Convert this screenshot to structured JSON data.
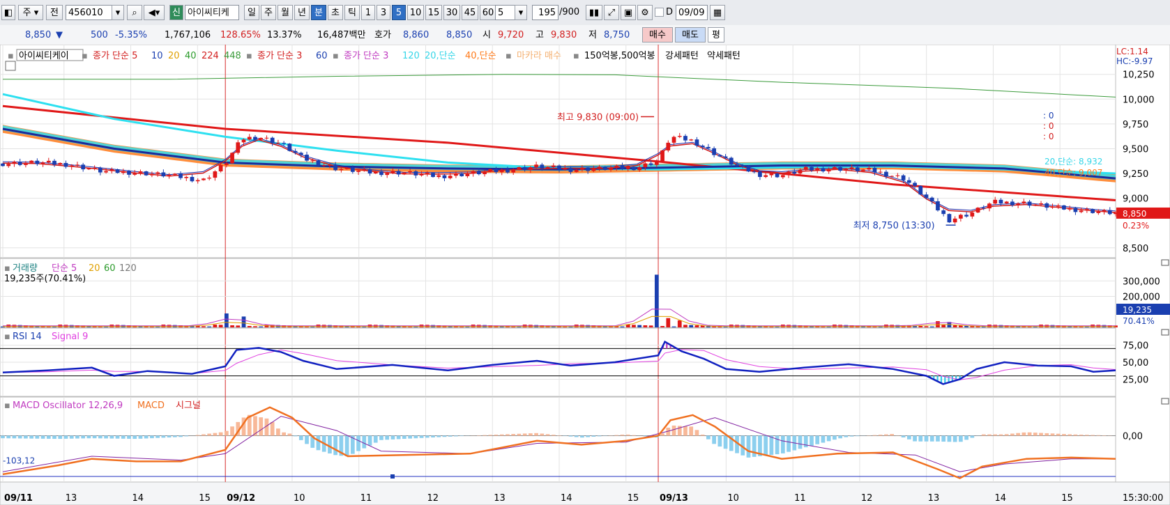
{
  "toolbar": {
    "market": "주",
    "prev": "전",
    "code": "456010",
    "new_badge": "신",
    "name": "아이씨티케",
    "periods": [
      "일",
      "주",
      "월",
      "년",
      "분",
      "초",
      "틱"
    ],
    "active_period": "분",
    "intervals": [
      "1",
      "3",
      "5",
      "10",
      "15",
      "30",
      "45",
      "60"
    ],
    "active_interval": "5",
    "interval_select": "5",
    "count": "195",
    "count_total": "/900",
    "date": "09/09"
  },
  "infobar": {
    "price": "8,850",
    "change_arrow": "▼",
    "change": "500",
    "change_pct": "-5.35%",
    "volume": "1,767,106",
    "vol_ratio": "128.65%",
    "turnover": "13.37%",
    "amount": "16,487백만",
    "quote_label": "호가",
    "ask": "8,860",
    "bid": "8,850",
    "open_label": "시",
    "open": "9,720",
    "high_label": "고",
    "high": "9,830",
    "low_label": "저",
    "low": "8,750",
    "buy_btn": "매수",
    "sell_btn": "매도",
    "eval_btn": "평"
  },
  "chart_data": {
    "type": "candlestick",
    "interval": "5분",
    "price_ylim": [
      8400,
      10550
    ],
    "price_ticks": [
      {
        "v": 10250,
        "t": "10,250"
      },
      {
        "v": 10000,
        "t": "10,000"
      },
      {
        "v": 9750,
        "t": "9,750"
      },
      {
        "v": 9500,
        "t": "9,500"
      },
      {
        "v": 9250,
        "t": "9,250"
      },
      {
        "v": 9000,
        "t": "9,000"
      },
      {
        "v": 8500,
        "t": "8,500"
      }
    ],
    "x_labels": [
      {
        "p": 0,
        "t": "09/11",
        "bold": true
      },
      {
        "p": 0.055,
        "t": "13"
      },
      {
        "p": 0.115,
        "t": "14"
      },
      {
        "p": 0.175,
        "t": "15"
      },
      {
        "p": 0.2,
        "t": "09/12",
        "bold": true
      },
      {
        "p": 0.26,
        "t": "10"
      },
      {
        "p": 0.32,
        "t": "11"
      },
      {
        "p": 0.38,
        "t": "12"
      },
      {
        "p": 0.44,
        "t": "13"
      },
      {
        "p": 0.5,
        "t": "14"
      },
      {
        "p": 0.56,
        "t": "15"
      },
      {
        "p": 0.589,
        "t": "09/13",
        "bold": true
      },
      {
        "p": 0.65,
        "t": "10"
      },
      {
        "p": 0.71,
        "t": "11"
      },
      {
        "p": 0.77,
        "t": "12"
      },
      {
        "p": 0.83,
        "t": "13"
      },
      {
        "p": 0.89,
        "t": "14"
      },
      {
        "p": 0.95,
        "t": "15"
      }
    ],
    "time_end": "15:30:00",
    "day_dividers": [
      0.2,
      0.589
    ],
    "lc": "LC:1.14",
    "hc": "HC:-9.97",
    "zero_labels": [
      ": 0",
      ": 0",
      ": 0"
    ],
    "legend": {
      "name": "아이씨티케이",
      "ma1": "종가 단순 5",
      "ma1_periods": [
        "10",
        "20",
        "40",
        "224",
        "448"
      ],
      "ma2": "종가 단순 3",
      "ma2_periods": [
        "60"
      ],
      "ma3": "종가 단순 3",
      "ma3_periods": [
        "120"
      ],
      "ma_20": "20,단순",
      "ma_40": "40,단순",
      "makara": "마카라 매수",
      "pattern": "150억봉,500억봉",
      "strong": "강세패턴",
      "weak": "약세패턴"
    },
    "right_labels": {
      "ma20": "20,단순: 8,932",
      "ma40": "40,단순: 9,007"
    },
    "ma20_value": 8932,
    "ma40_value": 9007,
    "current": {
      "price": 8850,
      "label": "8,850",
      "pct": "0.23%"
    },
    "high_annot": {
      "label": "최고 9,830 (09:00)",
      "value": 9830,
      "p": 0.589
    },
    "low_annot": {
      "label": "최저 8,750 (13:30)",
      "value": 8750,
      "p": 0.855
    },
    "ma224": [
      [
        0,
        9930
      ],
      [
        0.2,
        9700
      ],
      [
        0.4,
        9560
      ],
      [
        0.589,
        9370
      ],
      [
        0.8,
        9140
      ],
      [
        1,
        8980
      ]
    ],
    "ma448": [
      [
        0,
        10200
      ],
      [
        0.15,
        10200
      ],
      [
        0.3,
        10230
      ],
      [
        0.45,
        10250
      ],
      [
        0.55,
        10245
      ],
      [
        0.7,
        10170
      ],
      [
        0.85,
        10110
      ],
      [
        1,
        10020
      ]
    ],
    "ma120": [
      [
        0,
        10050
      ],
      [
        0.1,
        9800
      ],
      [
        0.2,
        9620
      ],
      [
        0.3,
        9480
      ],
      [
        0.4,
        9360
      ],
      [
        0.5,
        9300
      ],
      [
        0.589,
        9290
      ],
      [
        0.7,
        9310
      ],
      [
        0.8,
        9320
      ],
      [
        0.9,
        9290
      ],
      [
        1,
        9250
      ]
    ],
    "ma60": [
      [
        0,
        9700
      ],
      [
        0.1,
        9500
      ],
      [
        0.2,
        9360
      ],
      [
        0.3,
        9320
      ],
      [
        0.4,
        9300
      ],
      [
        0.5,
        9290
      ],
      [
        0.6,
        9310
      ],
      [
        0.7,
        9330
      ],
      [
        0.8,
        9330
      ],
      [
        0.9,
        9300
      ],
      [
        1,
        9200
      ]
    ],
    "price_path": [
      [
        0,
        9350
      ],
      [
        0.03,
        9360
      ],
      [
        0.06,
        9340
      ],
      [
        0.09,
        9270
      ],
      [
        0.12,
        9260
      ],
      [
        0.15,
        9230
      ],
      [
        0.18,
        9180
      ],
      [
        0.2,
        9350
      ],
      [
        0.215,
        9600
      ],
      [
        0.23,
        9620
      ],
      [
        0.25,
        9550
      ],
      [
        0.27,
        9400
      ],
      [
        0.3,
        9300
      ],
      [
        0.33,
        9260
      ],
      [
        0.36,
        9260
      ],
      [
        0.39,
        9220
      ],
      [
        0.42,
        9250
      ],
      [
        0.45,
        9280
      ],
      [
        0.48,
        9320
      ],
      [
        0.51,
        9290
      ],
      [
        0.54,
        9300
      ],
      [
        0.57,
        9310
      ],
      [
        0.589,
        9380
      ],
      [
        0.6,
        9620
      ],
      [
        0.62,
        9580
      ],
      [
        0.64,
        9450
      ],
      [
        0.66,
        9320
      ],
      [
        0.68,
        9240
      ],
      [
        0.7,
        9230
      ],
      [
        0.72,
        9290
      ],
      [
        0.75,
        9300
      ],
      [
        0.78,
        9280
      ],
      [
        0.81,
        9200
      ],
      [
        0.83,
        9000
      ],
      [
        0.85,
        8780
      ],
      [
        0.87,
        8850
      ],
      [
        0.89,
        8960
      ],
      [
        0.92,
        8950
      ],
      [
        0.95,
        8900
      ],
      [
        0.98,
        8870
      ],
      [
        1,
        8850
      ]
    ],
    "volume": {
      "label": "거래량",
      "ma": "단순 5",
      "ma_periods": [
        "20",
        "60",
        "120"
      ],
      "readout": "19,235주(70.41%)",
      "ticks": [
        {
          "v": 300000,
          "t": "300,000"
        },
        {
          "v": 200000,
          "t": "200,000"
        }
      ],
      "max": 400000,
      "current": "19,235",
      "current_pct": "70.41%",
      "spikes": [
        {
          "p": 0.2,
          "v": 90000
        },
        {
          "p": 0.215,
          "v": 70000
        },
        {
          "p": 0.589,
          "v": 340000
        },
        {
          "p": 0.6,
          "v": 60000
        },
        {
          "p": 0.61,
          "v": 45000
        },
        {
          "p": 0.84,
          "v": 40000
        },
        {
          "p": 0.85,
          "v": 35000
        }
      ]
    },
    "rsi": {
      "label": "RSI 14",
      "signal": "Signal 9",
      "ticks": [
        {
          "v": 75,
          "t": "75,00"
        },
        {
          "v": 50,
          "t": "50,00"
        },
        {
          "v": 25,
          "t": "25,00"
        }
      ],
      "levels": [
        70,
        30
      ],
      "path": [
        [
          0,
          35
        ],
        [
          0.04,
          38
        ],
        [
          0.08,
          42
        ],
        [
          0.1,
          30
        ],
        [
          0.13,
          37
        ],
        [
          0.17,
          33
        ],
        [
          0.2,
          44
        ],
        [
          0.21,
          68
        ],
        [
          0.23,
          71
        ],
        [
          0.25,
          65
        ],
        [
          0.27,
          52
        ],
        [
          0.3,
          40
        ],
        [
          0.35,
          46
        ],
        [
          0.4,
          38
        ],
        [
          0.44,
          46
        ],
        [
          0.48,
          52
        ],
        [
          0.51,
          45
        ],
        [
          0.55,
          50
        ],
        [
          0.589,
          60
        ],
        [
          0.595,
          80
        ],
        [
          0.61,
          66
        ],
        [
          0.63,
          55
        ],
        [
          0.65,
          40
        ],
        [
          0.68,
          36
        ],
        [
          0.72,
          42
        ],
        [
          0.76,
          47
        ],
        [
          0.8,
          40
        ],
        [
          0.83,
          30
        ],
        [
          0.845,
          18
        ],
        [
          0.86,
          25
        ],
        [
          0.875,
          40
        ],
        [
          0.9,
          50
        ],
        [
          0.93,
          45
        ],
        [
          0.96,
          44
        ],
        [
          0.98,
          36
        ],
        [
          1,
          38
        ]
      ]
    },
    "macd": {
      "label": "MACD Oscillator 12,26,9",
      "macd_label": "MACD",
      "signal_label": "시그널",
      "zero_tick": "0,00",
      "left_value": "-103,12",
      "range": [
        -180,
        150
      ],
      "macd_path": [
        [
          0,
          -150
        ],
        [
          0.05,
          -115
        ],
        [
          0.08,
          -90
        ],
        [
          0.12,
          -100
        ],
        [
          0.16,
          -100
        ],
        [
          0.2,
          -55
        ],
        [
          0.22,
          70
        ],
        [
          0.24,
          110
        ],
        [
          0.26,
          70
        ],
        [
          0.28,
          -10
        ],
        [
          0.31,
          -80
        ],
        [
          0.36,
          -75
        ],
        [
          0.42,
          -70
        ],
        [
          0.48,
          -20
        ],
        [
          0.52,
          -35
        ],
        [
          0.56,
          -20
        ],
        [
          0.589,
          0
        ],
        [
          0.6,
          60
        ],
        [
          0.62,
          80
        ],
        [
          0.64,
          35
        ],
        [
          0.67,
          -60
        ],
        [
          0.7,
          -90
        ],
        [
          0.75,
          -70
        ],
        [
          0.8,
          -65
        ],
        [
          0.84,
          -130
        ],
        [
          0.86,
          -165
        ],
        [
          0.88,
          -120
        ],
        [
          0.92,
          -90
        ],
        [
          0.96,
          -85
        ],
        [
          1,
          -90
        ]
      ],
      "signal_path": [
        [
          0,
          -140
        ],
        [
          0.08,
          -80
        ],
        [
          0.16,
          -95
        ],
        [
          0.2,
          -70
        ],
        [
          0.25,
          75
        ],
        [
          0.3,
          20
        ],
        [
          0.34,
          -60
        ],
        [
          0.42,
          -70
        ],
        [
          0.48,
          -30
        ],
        [
          0.56,
          -25
        ],
        [
          0.6,
          20
        ],
        [
          0.64,
          70
        ],
        [
          0.7,
          -20
        ],
        [
          0.76,
          -65
        ],
        [
          0.82,
          -75
        ],
        [
          0.86,
          -140
        ],
        [
          0.9,
          -110
        ],
        [
          0.96,
          -90
        ],
        [
          1,
          -90
        ]
      ]
    }
  }
}
